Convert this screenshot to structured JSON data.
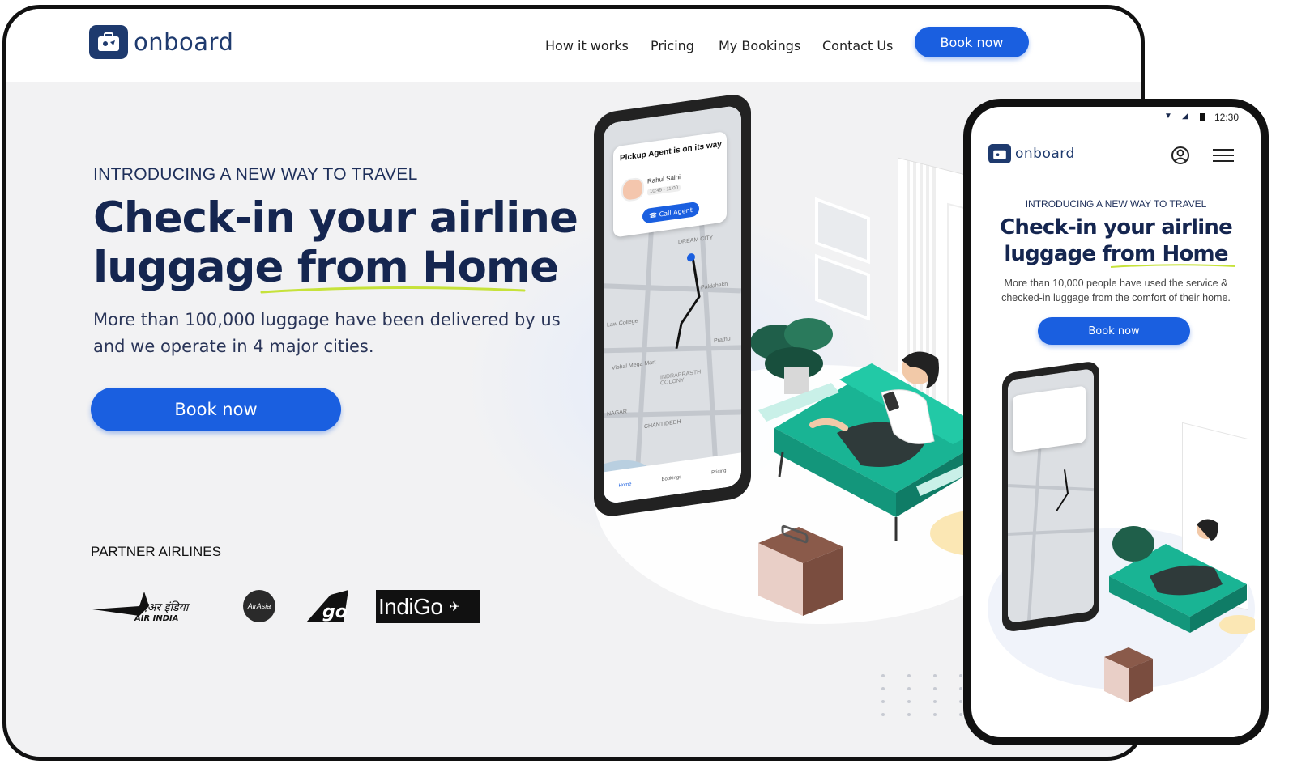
{
  "brand": {
    "name": "onboard",
    "color": "#1e3a6e",
    "accent": "#1a5fe0",
    "highlight": "#c6e23a"
  },
  "nav": {
    "items": [
      "How it works",
      "Pricing",
      "My Bookings",
      "Contact Us"
    ],
    "cta": "Book now"
  },
  "hero": {
    "kicker": "INTRODUCING A NEW WAY TO TRAVEL",
    "title_line1": "Check-in your airline",
    "title_line2": "luggage from Home",
    "subtitle": "More than 100,000 luggage have been delivered by us and we operate in 4 major cities.",
    "cta": "Book now"
  },
  "partners": {
    "label": "PARTNER AIRLINES",
    "logos": [
      {
        "name": "AIR INDIA",
        "hindi": "एअर इंडिया"
      },
      {
        "name": "AirAsia"
      },
      {
        "name": "go"
      },
      {
        "name": "IndiGo"
      }
    ]
  },
  "illustration": {
    "card_title": "Pickup Agent is on its way",
    "agent_name": "Rahul Saini",
    "time_slot": "10:45 - 11:00",
    "call_button": "Call Agent",
    "map_labels": [
      "DREAM CITY",
      "Paldahakh",
      "Law College",
      "Vishal Mega Mart",
      "INDRAPRASTH COLONY",
      "CHANTIDEEH",
      "NAGAR",
      "Prathu"
    ],
    "tabs": [
      "Home",
      "Bookings",
      "Pricing"
    ]
  },
  "mobile": {
    "status_time": "12:30",
    "brand": "onboard",
    "kicker": "INTRODUCING A NEW WAY TO TRAVEL",
    "title_line1": "Check-in your airline",
    "title_line2": "luggage from Home",
    "subtitle": "More than 10,000 people  have used the service & checked-in luggage from the comfort of their home.",
    "cta": "Book now"
  },
  "icons": [
    "suitcase-logo-icon",
    "account-icon",
    "menu-icon",
    "wifi-icon",
    "signal-icon",
    "battery-icon"
  ]
}
